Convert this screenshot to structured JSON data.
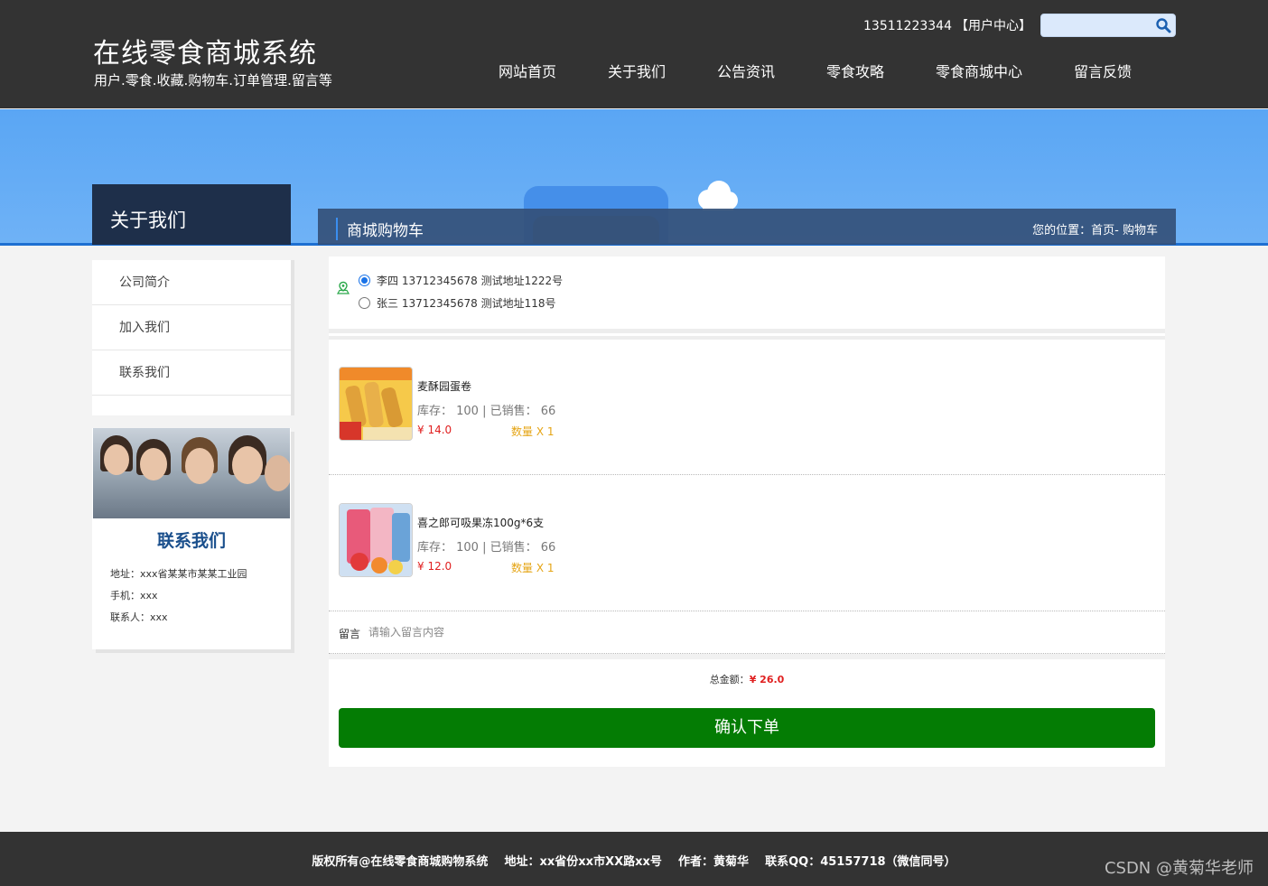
{
  "header": {
    "title": "在线零食商城系统",
    "subtitle": "用户.零食.收藏.购物车.订单管理.留言等",
    "phone": "13511223344",
    "user_center": "【用户中心】",
    "search_placeholder": ""
  },
  "nav": {
    "items": [
      {
        "label": "网站首页"
      },
      {
        "label": "关于我们"
      },
      {
        "label": "公告资讯"
      },
      {
        "label": "零食攻略"
      },
      {
        "label": "零食商城中心"
      },
      {
        "label": "留言反馈"
      }
    ]
  },
  "sidebar": {
    "heading": "关于我们",
    "items": [
      {
        "label": "公司简介"
      },
      {
        "label": "加入我们"
      },
      {
        "label": "联系我们"
      }
    ],
    "contact": {
      "title": "联系我们",
      "address": "地址：xxx省某某市某某工业园",
      "phone": "手机：xxx",
      "person": "联系人：xxx"
    }
  },
  "cart": {
    "title": "商城购物车",
    "breadcrumb": "您的位置：首页- 购物车",
    "addresses": [
      {
        "text": "李四 13712345678 测试地址1222号",
        "selected": true
      },
      {
        "text": "张三 13712345678 测试地址118号",
        "selected": false
      }
    ],
    "products": [
      {
        "name": "麦酥园蛋卷",
        "stock": "库存： 100 | 已销售： 66",
        "price": "¥ 14.0",
        "qty": "数量 X 1"
      },
      {
        "name": "喜之郎可吸果冻100g*6支",
        "stock": "库存： 100 | 已销售： 66",
        "price": "¥ 12.0",
        "qty": "数量 X 1"
      }
    ],
    "message_label": "留言",
    "message_placeholder": "请输入留言内容",
    "total_label": "总金额：",
    "total_value": "¥ 26.0",
    "submit_label": "确认下单"
  },
  "footer": {
    "text": "版权所有@在线零食商城购物系统    地址：xx省份xx市XX路xx号    作者：黄菊华    联系QQ：45157718（微信同号）",
    "watermark": "CSDN @黄菊华老师"
  },
  "colors": {
    "header_bg": "#333333",
    "banner_blue": "#5aa6f4",
    "accent_blue": "#1d6fd1",
    "submit_green": "#047c04",
    "price_red": "#e02020",
    "qty_orange": "#e5a516"
  }
}
